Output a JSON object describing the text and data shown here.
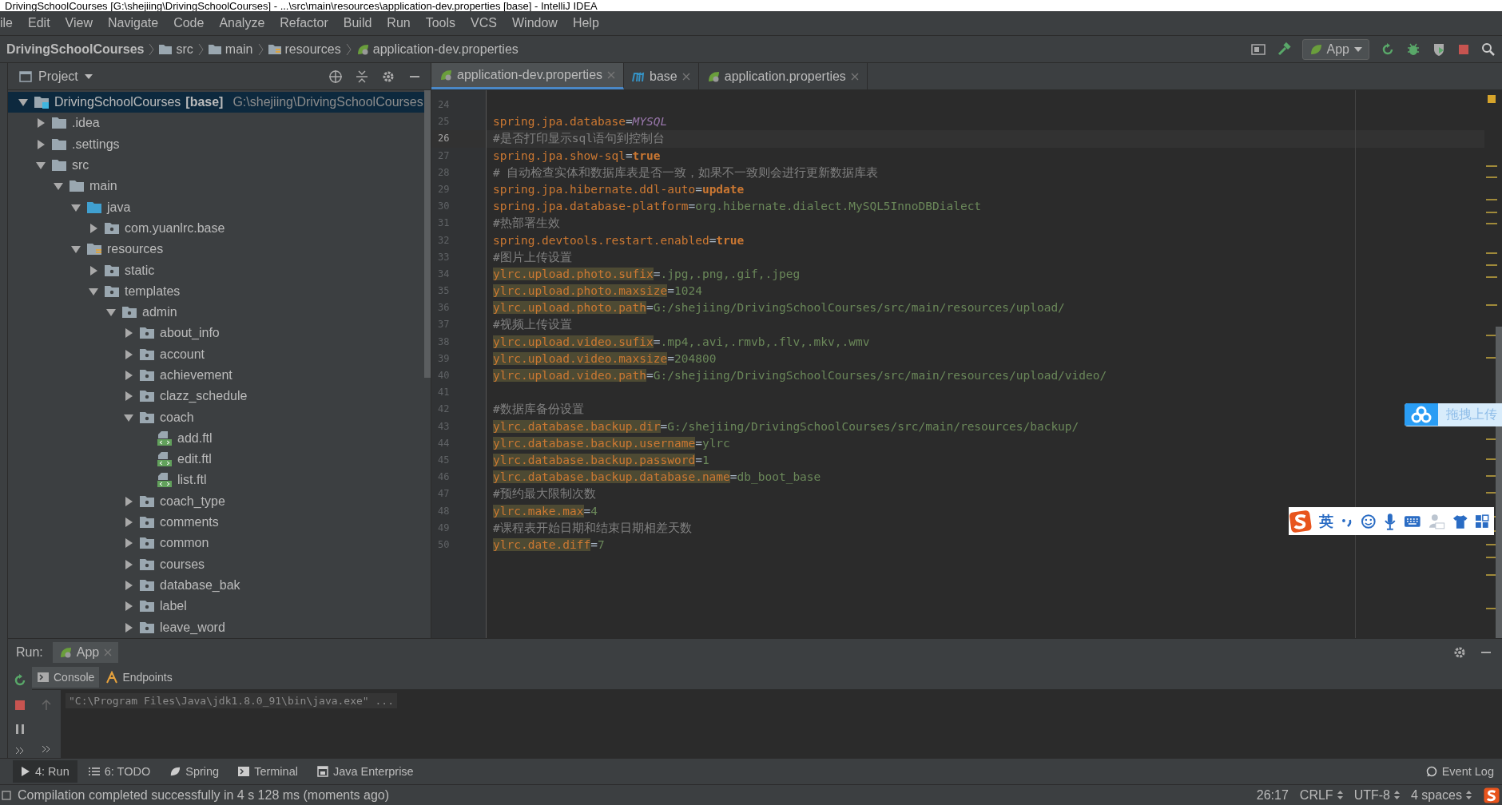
{
  "window": {
    "title": "DrivingSchoolCourses [G:\\shejiing\\DrivingSchoolCourses] - ...\\src\\main\\resources\\application-dev.properties [base] - IntelliJ IDEA"
  },
  "menu": [
    "ile",
    "Edit",
    "View",
    "Navigate",
    "Code",
    "Analyze",
    "Refactor",
    "Build",
    "Run",
    "Tools",
    "VCS",
    "Window",
    "Help"
  ],
  "breadcrumbs": [
    {
      "label": "DrivingSchoolCourses",
      "kind": "project"
    },
    {
      "label": "src",
      "kind": "folder"
    },
    {
      "label": "main",
      "kind": "folder"
    },
    {
      "label": "resources",
      "kind": "resources"
    },
    {
      "label": "application-dev.properties",
      "kind": "properties"
    }
  ],
  "run_config": {
    "label": "App"
  },
  "project": {
    "title": "Project",
    "tree": [
      {
        "name": "DrivingSchoolCourses",
        "tag": "[base]",
        "path": "G:\\shejiing\\DrivingSchoolCourses",
        "kind": "module",
        "expanded": true,
        "selected": true,
        "children": [
          {
            "name": ".idea",
            "kind": "folder",
            "expanded": false,
            "selected": false
          },
          {
            "name": ".settings",
            "kind": "folder",
            "expanded": false,
            "selected": false
          },
          {
            "name": "src",
            "kind": "folder",
            "expanded": true,
            "selected": false,
            "children": [
              {
                "name": "main",
                "kind": "folder",
                "expanded": true,
                "selected": false,
                "children": [
                  {
                    "name": "java",
                    "kind": "source",
                    "expanded": true,
                    "selected": false,
                    "children": [
                      {
                        "name": "com.yuanlrc.base",
                        "kind": "package",
                        "expanded": false,
                        "selected": false
                      }
                    ]
                  },
                  {
                    "name": "resources",
                    "kind": "resources",
                    "expanded": true,
                    "selected": false,
                    "children": [
                      {
                        "name": "static",
                        "kind": "package",
                        "expanded": false,
                        "selected": false
                      },
                      {
                        "name": "templates",
                        "kind": "package",
                        "expanded": true,
                        "selected": false,
                        "children": [
                          {
                            "name": "admin",
                            "kind": "package",
                            "expanded": true,
                            "selected": false,
                            "children": [
                              {
                                "name": "about_info",
                                "kind": "package",
                                "expanded": false,
                                "selected": false
                              },
                              {
                                "name": "account",
                                "kind": "package",
                                "expanded": false,
                                "selected": false
                              },
                              {
                                "name": "achievement",
                                "kind": "package",
                                "expanded": false,
                                "selected": false
                              },
                              {
                                "name": "clazz_schedule",
                                "kind": "package",
                                "expanded": false,
                                "selected": false
                              },
                              {
                                "name": "coach",
                                "kind": "package",
                                "expanded": true,
                                "selected": false,
                                "children": [
                                  {
                                    "name": "add.ftl",
                                    "kind": "ftl",
                                    "selected": false
                                  },
                                  {
                                    "name": "edit.ftl",
                                    "kind": "ftl",
                                    "selected": false
                                  },
                                  {
                                    "name": "list.ftl",
                                    "kind": "ftl",
                                    "selected": false
                                  }
                                ]
                              },
                              {
                                "name": "coach_type",
                                "kind": "package",
                                "expanded": false,
                                "selected": false
                              },
                              {
                                "name": "comments",
                                "kind": "package",
                                "expanded": false,
                                "selected": false
                              },
                              {
                                "name": "common",
                                "kind": "package",
                                "expanded": false,
                                "selected": false
                              },
                              {
                                "name": "courses",
                                "kind": "package",
                                "expanded": false,
                                "selected": false
                              },
                              {
                                "name": "database_bak",
                                "kind": "package",
                                "expanded": false,
                                "selected": false
                              },
                              {
                                "name": "label",
                                "kind": "package",
                                "expanded": false,
                                "selected": false
                              },
                              {
                                "name": "leave_word",
                                "kind": "package",
                                "expanded": false,
                                "selected": false
                              }
                            ]
                          }
                        ]
                      }
                    ]
                  }
                ]
              }
            ]
          }
        ]
      }
    ]
  },
  "editor": {
    "tabs": [
      {
        "label": "application-dev.properties",
        "kind": "properties",
        "selected": true
      },
      {
        "label": "base",
        "kind": "module",
        "selected": false
      },
      {
        "label": "application.properties",
        "kind": "properties",
        "selected": false
      }
    ],
    "lines": [
      {
        "num": "24",
        "kind": "blank",
        "current": false
      },
      {
        "num": "25",
        "kind": "property",
        "key": "spring.jpa.database",
        "eq": "=",
        "value": {
          "text": "MYSQL",
          "kind": "enum"
        },
        "highlighted": false,
        "current": false
      },
      {
        "num": "26",
        "kind": "comment",
        "text": "#是否打印显示sql语句到控制台",
        "current": true
      },
      {
        "num": "27",
        "kind": "property",
        "key": "spring.jpa.show-sql",
        "eq": "=",
        "value": {
          "text": "true",
          "kind": "keyword"
        },
        "highlighted": false,
        "current": false
      },
      {
        "num": "28",
        "kind": "comment",
        "text": "# 自动检查实体和数据库表是否一致，如果不一致则会进行更新数据库表",
        "current": false
      },
      {
        "num": "29",
        "kind": "property",
        "key": "spring.jpa.hibernate.ddl-auto",
        "eq": "=",
        "value": {
          "text": "update",
          "kind": "keyword"
        },
        "highlighted": false,
        "current": false
      },
      {
        "num": "30",
        "kind": "property",
        "key": "spring.jpa.database-platform",
        "eq": "=",
        "value": {
          "text": "org.hibernate.dialect.MySQL5InnoDBDialect",
          "kind": "string"
        },
        "highlighted": false,
        "current": false
      },
      {
        "num": "31",
        "kind": "comment",
        "text": "#热部署生效",
        "current": false
      },
      {
        "num": "32",
        "kind": "property",
        "key": "spring.devtools.restart.enabled",
        "eq": "=",
        "value": {
          "text": "true",
          "kind": "keyword"
        },
        "highlighted": false,
        "current": false
      },
      {
        "num": "33",
        "kind": "comment",
        "text": "#图片上传设置",
        "current": false
      },
      {
        "num": "34",
        "kind": "property",
        "key": "ylrc.upload.photo.sufix",
        "eq": "=",
        "value": {
          "text": ".jpg,.png,.gif,.jpeg",
          "kind": "string"
        },
        "highlighted": true,
        "current": false
      },
      {
        "num": "35",
        "kind": "property",
        "key": "ylrc.upload.photo.maxsize",
        "eq": "=",
        "value": {
          "text": "1024",
          "kind": "string"
        },
        "highlighted": true,
        "current": false
      },
      {
        "num": "36",
        "kind": "property",
        "key": "ylrc.upload.photo.path",
        "eq": "=",
        "value": {
          "text": "G:/shejiing/DrivingSchoolCourses/src/main/resources/upload/",
          "kind": "string"
        },
        "highlighted": true,
        "current": false
      },
      {
        "num": "37",
        "kind": "comment",
        "text": "#视频上传设置",
        "current": false
      },
      {
        "num": "38",
        "kind": "property",
        "key": "ylrc.upload.video.sufix",
        "eq": "=",
        "value": {
          "text": ".mp4,.avi,.rmvb,.flv,.mkv,.wmv",
          "kind": "string"
        },
        "highlighted": true,
        "current": false
      },
      {
        "num": "39",
        "kind": "property",
        "key": "ylrc.upload.video.maxsize",
        "eq": "=",
        "value": {
          "text": "204800",
          "kind": "string"
        },
        "highlighted": true,
        "current": false
      },
      {
        "num": "40",
        "kind": "property",
        "key": "ylrc.upload.video.path",
        "eq": "=",
        "value": {
          "text": "G:/shejiing/DrivingSchoolCourses/src/main/resources/upload/video/",
          "kind": "string"
        },
        "highlighted": true,
        "current": false
      },
      {
        "num": "41",
        "kind": "blank",
        "current": false
      },
      {
        "num": "42",
        "kind": "comment",
        "text": "#数据库备份设置",
        "current": false
      },
      {
        "num": "43",
        "kind": "property",
        "key": "ylrc.database.backup.dir",
        "eq": "=",
        "value": {
          "text": "G:/shejiing/DrivingSchoolCourses/src/main/resources/backup/",
          "kind": "string"
        },
        "highlighted": true,
        "current": false
      },
      {
        "num": "44",
        "kind": "property",
        "key": "ylrc.database.backup.username",
        "eq": "=",
        "value": {
          "text": "ylrc",
          "kind": "string"
        },
        "highlighted": true,
        "current": false
      },
      {
        "num": "45",
        "kind": "property",
        "key": "ylrc.database.backup.password",
        "eq": "=",
        "value": {
          "text": "1",
          "kind": "string"
        },
        "highlighted": true,
        "current": false
      },
      {
        "num": "46",
        "kind": "property",
        "key": "ylrc.database.backup.database.name",
        "eq": "=",
        "value": {
          "text": "db_boot_base",
          "kind": "string"
        },
        "highlighted": true,
        "current": false
      },
      {
        "num": "47",
        "kind": "comment",
        "text": "#预约最大限制次数",
        "current": false
      },
      {
        "num": "48",
        "kind": "property",
        "key": "ylrc.make.max",
        "eq": "=",
        "value": {
          "text": "4",
          "kind": "string"
        },
        "highlighted": true,
        "current": false
      },
      {
        "num": "49",
        "kind": "comment",
        "text": "#课程表开始日期和结束日期相差天数",
        "current": false
      },
      {
        "num": "50",
        "kind": "property",
        "key": "ylrc.date.diff",
        "eq": "=",
        "value": {
          "text": "7",
          "kind": "string"
        },
        "highlighted": true,
        "current": false
      }
    ]
  },
  "upload_widget": {
    "label": "拖拽上传"
  },
  "ime_bar": {
    "mode": "英"
  },
  "run": {
    "label": "Run:",
    "tabs": [
      {
        "label": "App",
        "selected": true
      }
    ],
    "console_tabs": [
      {
        "label": "Console",
        "kind": "console",
        "selected": true
      },
      {
        "label": "Endpoints",
        "kind": "endpoints",
        "selected": false
      }
    ],
    "output": [
      "\"C:\\Program Files\\Java\\jdk1.8.0_91\\bin\\java.exe\" ..."
    ]
  },
  "tool_windows": [
    {
      "label": "4: Run",
      "kind": "run",
      "selected": true
    },
    {
      "label": "6: TODO",
      "kind": "todo",
      "selected": false
    },
    {
      "label": "Spring",
      "kind": "spring",
      "selected": false
    },
    {
      "label": "Terminal",
      "kind": "terminal",
      "selected": false
    },
    {
      "label": "Java Enterprise",
      "kind": "javaee",
      "selected": false
    }
  ],
  "event_log": {
    "label": "Event Log"
  },
  "status": {
    "message": "Compilation completed successfully in 4 s 128 ms (moments ago)",
    "items": [
      {
        "label": "26:17",
        "dropdown": false
      },
      {
        "label": "CRLF",
        "dropdown": true
      },
      {
        "label": "UTF-8",
        "dropdown": true
      },
      {
        "label": "4 spaces",
        "dropdown": true
      }
    ]
  }
}
